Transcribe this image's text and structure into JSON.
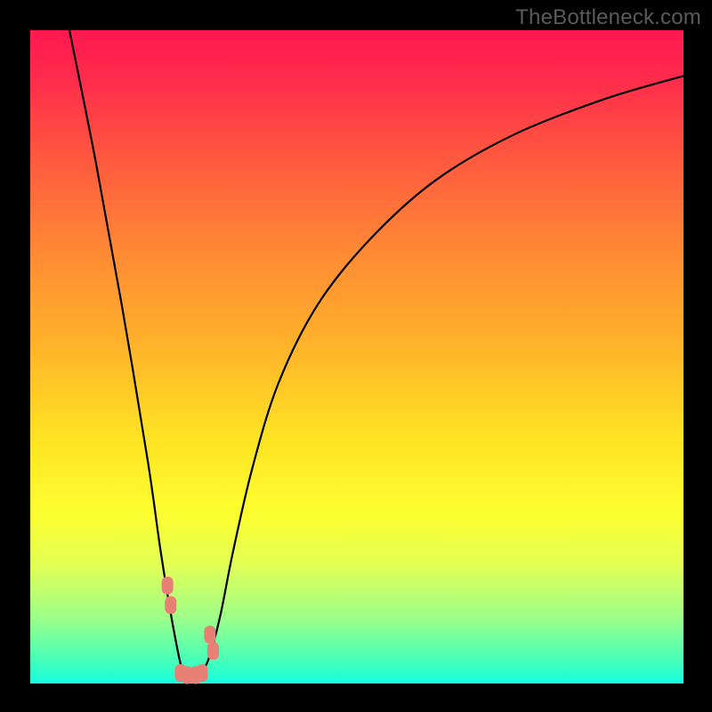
{
  "watermark": "TheBottleneck.com",
  "colors": {
    "page_bg": "#000000",
    "gradient_top": "#ff1850",
    "gradient_mid1": "#ffb22a",
    "gradient_mid2": "#fdff30",
    "gradient_bottom": "#15ffdf",
    "curve": "#000000",
    "marker": "#e98076",
    "watermark": "#5a5a5a"
  },
  "chart_data": {
    "type": "line",
    "title": "",
    "xlabel": "",
    "ylabel": "",
    "xlim": [
      0,
      100
    ],
    "ylim": [
      0,
      100
    ],
    "note": "V-shaped bottleneck curve. Values are approximate, read from pixel positions (y: 0=bottom/green, 100=top/red).",
    "series": [
      {
        "name": "bottleneck-curve",
        "x": [
          6,
          10,
          14,
          18,
          20,
          22,
          23.5,
          25,
          27,
          29,
          31,
          34,
          38,
          44,
          52,
          62,
          74,
          88,
          100
        ],
        "y": [
          100,
          80,
          58,
          34,
          20,
          8,
          1.5,
          1.5,
          3,
          10,
          20,
          33,
          46,
          58,
          68,
          77,
          84,
          89.5,
          93
        ]
      }
    ],
    "markers": [
      {
        "name": "left-upper-cluster",
        "x": 21.0,
        "y": 15.0
      },
      {
        "name": "left-upper-cluster",
        "x": 21.5,
        "y": 12.0
      },
      {
        "name": "right-upper-cluster",
        "x": 27.5,
        "y": 7.5
      },
      {
        "name": "right-upper-cluster",
        "x": 28.0,
        "y": 5.0
      },
      {
        "name": "bottom-cluster",
        "x": 23.0,
        "y": 1.6
      },
      {
        "name": "bottom-cluster",
        "x": 24.0,
        "y": 1.3
      },
      {
        "name": "bottom-cluster",
        "x": 25.3,
        "y": 1.3
      },
      {
        "name": "bottom-cluster",
        "x": 26.3,
        "y": 1.6
      }
    ]
  }
}
